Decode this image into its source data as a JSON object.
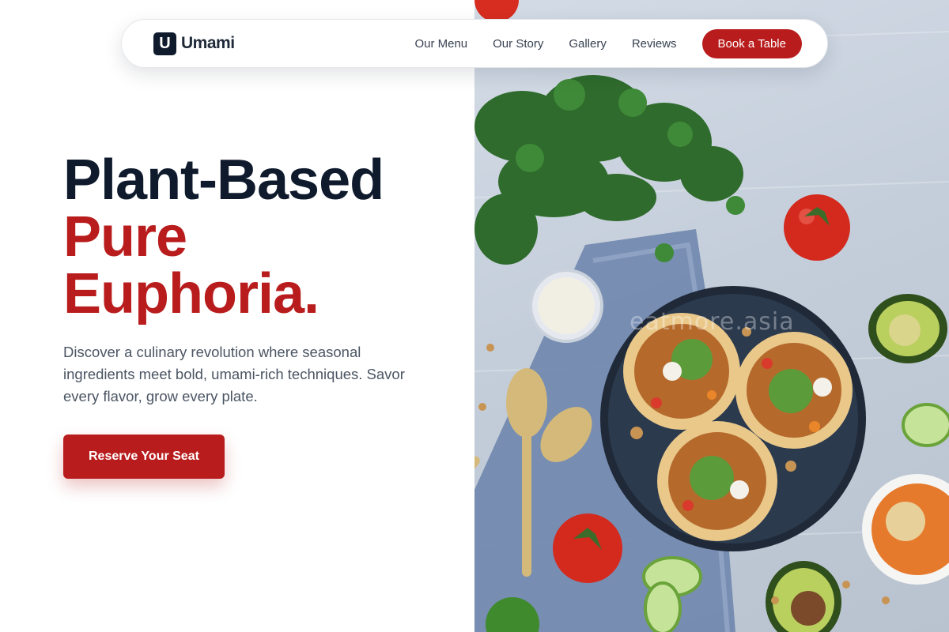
{
  "brand": {
    "logo_letter": "U",
    "name": "Umami"
  },
  "nav": {
    "links": [
      "Our Menu",
      "Our Story",
      "Gallery",
      "Reviews"
    ],
    "cta": "Book a Table"
  },
  "hero": {
    "headline_line1": "Plant-Based",
    "headline_line2": "Pure",
    "headline_line3": "Euphoria.",
    "description": "Discover a culinary revolution where seasonal ingredients meet bold, umami-rich techniques. Savor every flavor, grow every plate.",
    "cta": "Reserve Your Seat"
  },
  "image": {
    "watermark": "eatmore.asia"
  },
  "colors": {
    "accent": "#b91c1c",
    "dark": "#0f1b2d",
    "text_muted": "#4b5563"
  }
}
